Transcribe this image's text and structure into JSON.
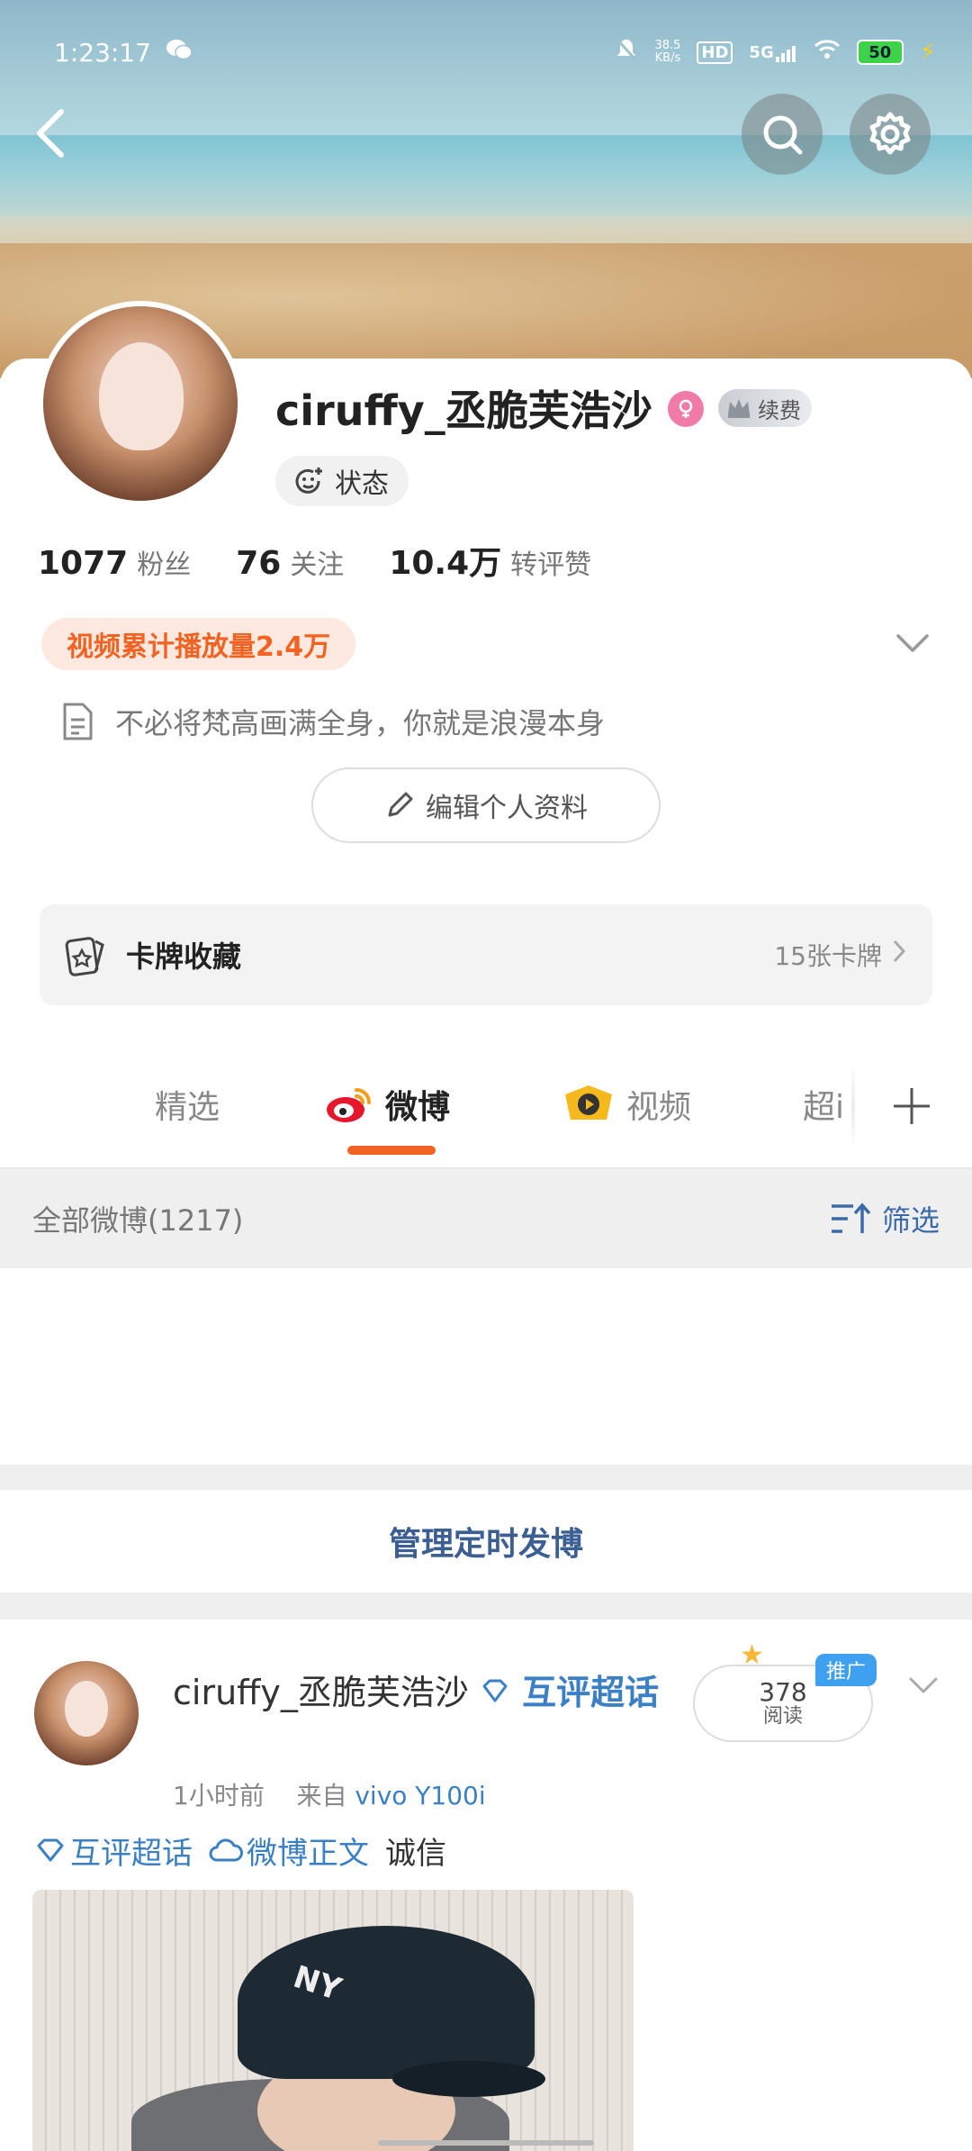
{
  "status_bar": {
    "time": "1:23:17",
    "net_speed_value": "38.5",
    "net_speed_unit": "KB/s",
    "hd": "HD",
    "network": "5G",
    "battery": "50"
  },
  "profile": {
    "name": "ciruffy_丞脆芙浩沙",
    "vip_label": "续费",
    "state_label": "状态",
    "stats": [
      {
        "value": "1077",
        "label": "粉丝"
      },
      {
        "value": "76",
        "label": "关注"
      },
      {
        "value": "10.4万",
        "label": "转评赞"
      }
    ],
    "video_plays": "视频累计播放量2.4万",
    "bio": "不必将梵高画满全身，你就是浪漫本身",
    "edit_label": "编辑个人资料"
  },
  "card_collection": {
    "label": "卡牌收藏",
    "count": "15张卡牌"
  },
  "tabs": {
    "items": [
      "精选",
      "微博",
      "视频",
      "超话"
    ],
    "partial_visible": "超i",
    "active": "微博"
  },
  "feed": {
    "all_label": "全部微博(1217)",
    "filter_label": "筛选",
    "manage_label": "管理定时发博"
  },
  "post": {
    "author": "ciruffy_丞脆芙浩沙",
    "topic_label": "互评超话",
    "time": "1小时前",
    "from_label": "来自",
    "source": "vivo Y100i",
    "read_count": "378",
    "read_label": "阅读",
    "promo_label": "推广",
    "tags": [
      {
        "label": "互评超话",
        "icon": "diamond-icon"
      },
      {
        "label": "微博正文",
        "icon": "cloud-icon"
      }
    ],
    "trailing_text": "诚信",
    "image_text": "NY"
  },
  "colors": {
    "accent_orange": "#f26222",
    "link_blue": "#3b7fc4",
    "manage_blue": "#3b5f92"
  }
}
